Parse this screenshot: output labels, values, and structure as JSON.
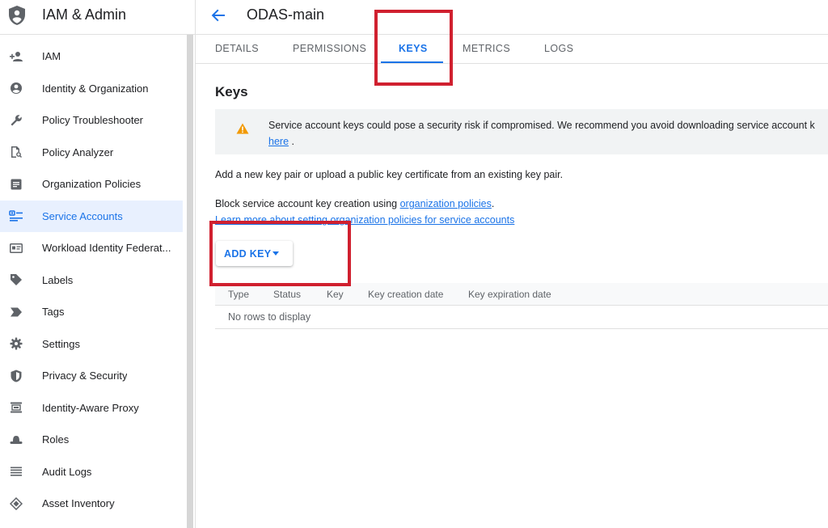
{
  "app": {
    "title": "IAM & Admin"
  },
  "sidebar": {
    "items": [
      {
        "label": "IAM",
        "icon": "person-add-icon"
      },
      {
        "label": "Identity & Organization",
        "icon": "account-circle-icon"
      },
      {
        "label": "Policy Troubleshooter",
        "icon": "wrench-icon"
      },
      {
        "label": "Policy Analyzer",
        "icon": "document-search-icon"
      },
      {
        "label": "Organization Policies",
        "icon": "list-document-icon"
      },
      {
        "label": "Service Accounts",
        "icon": "service-account-icon"
      },
      {
        "label": "Workload Identity Federat...",
        "icon": "id-card-icon"
      },
      {
        "label": "Labels",
        "icon": "label-icon"
      },
      {
        "label": "Tags",
        "icon": "tag-chevron-icon"
      },
      {
        "label": "Settings",
        "icon": "gear-icon"
      },
      {
        "label": "Privacy & Security",
        "icon": "shield-icon"
      },
      {
        "label": "Identity-Aware Proxy",
        "icon": "proxy-icon"
      },
      {
        "label": "Roles",
        "icon": "hat-icon"
      },
      {
        "label": "Audit Logs",
        "icon": "list-lines-icon"
      },
      {
        "label": "Asset Inventory",
        "icon": "diamond-icon"
      }
    ],
    "active_index": 5
  },
  "header": {
    "title": "ODAS-main"
  },
  "tabs": [
    {
      "label": "DETAILS"
    },
    {
      "label": "PERMISSIONS"
    },
    {
      "label": "KEYS"
    },
    {
      "label": "METRICS"
    },
    {
      "label": "LOGS"
    }
  ],
  "active_tab": "KEYS",
  "main": {
    "heading": "Keys",
    "warning": {
      "text_line1": "Service account keys could pose a security risk if compromised. We recommend you avoid downloading service account k",
      "link_text": "here",
      "text_line2_suffix": " ."
    },
    "para1": "Add a new key pair or upload a public key certificate from an existing key pair.",
    "para2_prefix": "Block service account key creation using ",
    "para2_link": "organization policies",
    "para2_suffix": ".",
    "learn_more_link": "Learn more about setting organization policies for service accounts",
    "add_key_label": "ADD KEY"
  },
  "table": {
    "columns": [
      "Type",
      "Status",
      "Key",
      "Key creation date",
      "Key expiration date"
    ],
    "empty_text": "No rows to display"
  },
  "colors": {
    "accent": "#1a73e8",
    "highlight": "#d0202f",
    "warning": "#f29900"
  }
}
